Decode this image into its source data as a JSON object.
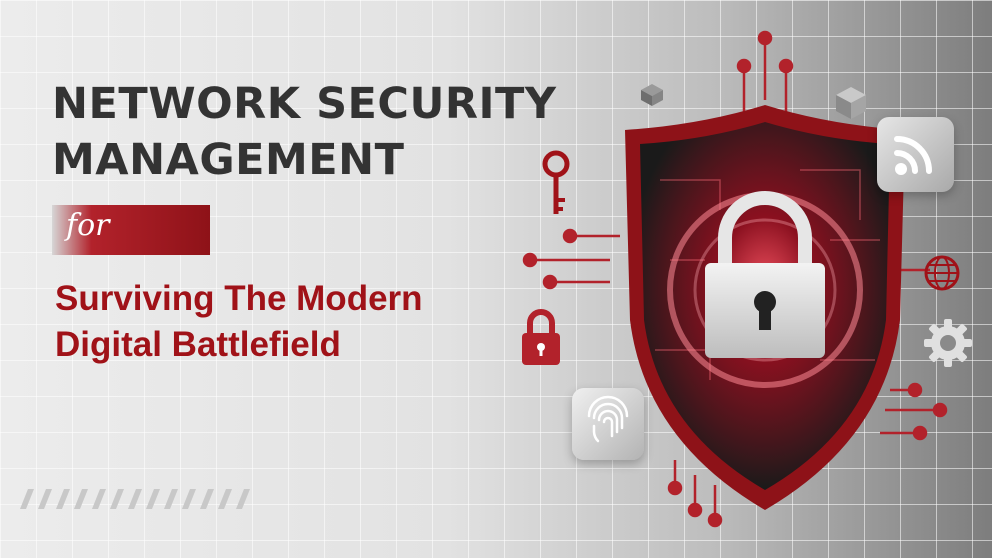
{
  "headline": {
    "line1": "NETWORK SECURITY",
    "line2": "MANAGEMENT"
  },
  "connector": "for",
  "subtitle": {
    "line1": "Surviving The Modern",
    "line2": "Digital Battlefield"
  },
  "icons": [
    "key-icon",
    "padlock-icon",
    "shield-icon",
    "wifi-icon",
    "globe-icon",
    "gear-icon",
    "fingerprint-icon",
    "cube-icon"
  ],
  "colors": {
    "accent_red": "#a01218",
    "dark_red": "#8e1218",
    "headline_gray": "#333333"
  }
}
